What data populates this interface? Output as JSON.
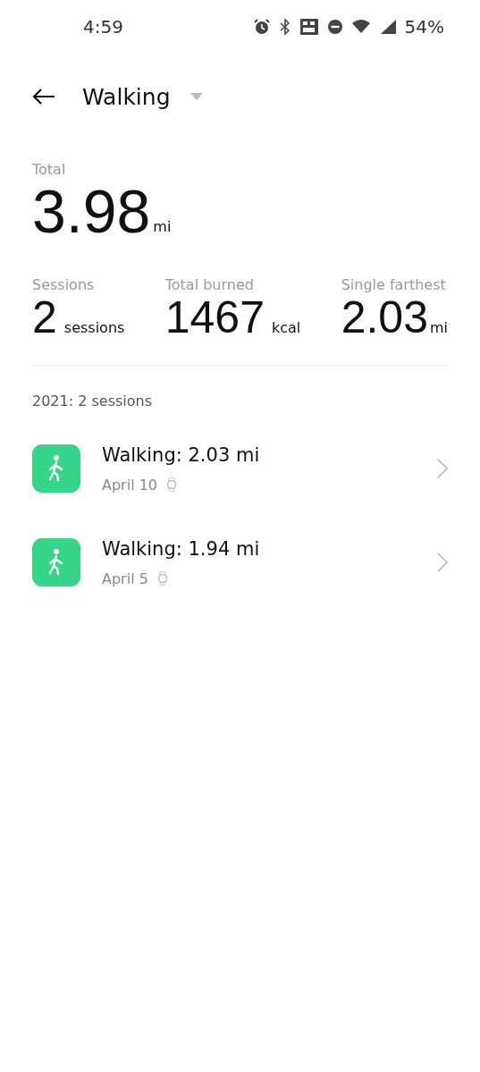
{
  "status_bar": {
    "time": "4:59",
    "battery": "54%"
  },
  "header": {
    "title": "Walking"
  },
  "total": {
    "label": "Total",
    "value": "3.98",
    "unit": "mi"
  },
  "stats": [
    {
      "label": "Sessions",
      "value": "2",
      "unit": "sessions"
    },
    {
      "label": "Total burned",
      "value": "1467",
      "unit": "kcal"
    },
    {
      "label": "Single farthest",
      "value": "2.03",
      "unit": "mi"
    }
  ],
  "year_heading": "2021: 2 sessions",
  "sessions": [
    {
      "title": "Walking: 2.03 mi",
      "date": "April 10"
    },
    {
      "title": "Walking: 1.94 mi",
      "date": "April 5"
    }
  ]
}
